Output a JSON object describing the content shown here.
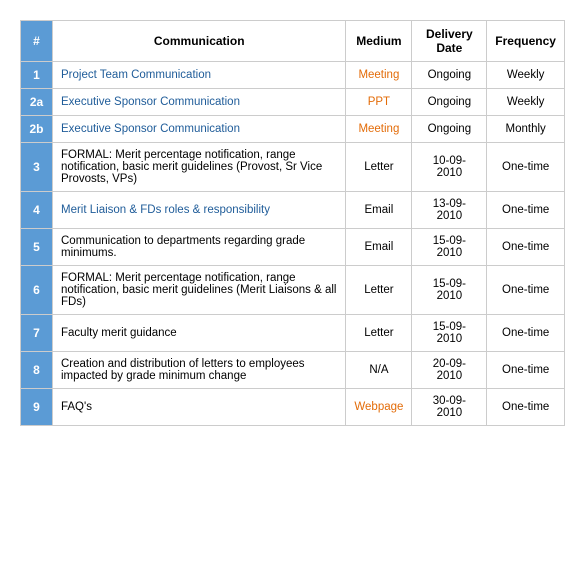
{
  "table": {
    "headers": {
      "hash": "#",
      "communication": "Communication",
      "medium": "Medium",
      "delivery_date": "Delivery Date",
      "frequency": "Frequency"
    },
    "rows": [
      {
        "id": "1",
        "communication": "Project Team Communication",
        "comm_blue": true,
        "medium": "Meeting",
        "medium_class": "medium-meeting",
        "delivery_date": "Ongoing",
        "frequency": "Weekly"
      },
      {
        "id": "2a",
        "communication": "Executive Sponsor Communication",
        "comm_blue": true,
        "medium": "PPT",
        "medium_class": "medium-ppt",
        "delivery_date": "Ongoing",
        "frequency": "Weekly"
      },
      {
        "id": "2b",
        "communication": "Executive Sponsor Communication",
        "comm_blue": true,
        "medium": "Meeting",
        "medium_class": "medium-meeting",
        "delivery_date": "Ongoing",
        "frequency": "Monthly"
      },
      {
        "id": "3",
        "communication": "FORMAL: Merit percentage notification, range notification, basic merit guidelines (Provost, Sr Vice Provosts, VPs)",
        "comm_blue": false,
        "medium": "Letter",
        "medium_class": "medium-letter",
        "delivery_date": "10-09-2010",
        "frequency": "One-time"
      },
      {
        "id": "4",
        "communication": "Merit Liaison & FDs roles & responsibility",
        "comm_blue": true,
        "medium": "Email",
        "medium_class": "medium-email",
        "delivery_date": "13-09-2010",
        "frequency": "One-time"
      },
      {
        "id": "5",
        "communication": "Communication to departments regarding grade minimums.",
        "comm_blue": false,
        "medium": "Email",
        "medium_class": "medium-email",
        "delivery_date": "15-09-2010",
        "frequency": "One-time"
      },
      {
        "id": "6",
        "communication": "FORMAL: Merit percentage notification, range notification, basic merit guidelines (Merit Liaisons & all FDs)",
        "comm_blue": false,
        "medium": "Letter",
        "medium_class": "medium-letter",
        "delivery_date": "15-09-2010",
        "frequency": "One-time"
      },
      {
        "id": "7",
        "communication": "Faculty merit guidance",
        "comm_blue": false,
        "medium": "Letter",
        "medium_class": "medium-letter",
        "delivery_date": "15-09-2010",
        "frequency": "One-time"
      },
      {
        "id": "8",
        "communication": "Creation and distribution of letters to employees impacted by grade minimum change",
        "comm_blue": false,
        "medium": "N/A",
        "medium_class": "medium-na",
        "delivery_date": "20-09-2010",
        "frequency": "One-time"
      },
      {
        "id": "9",
        "communication": "FAQ's",
        "comm_blue": false,
        "medium": "Webpage",
        "medium_class": "medium-webpage",
        "delivery_date": "30-09-2010",
        "frequency": "One-time"
      }
    ]
  }
}
